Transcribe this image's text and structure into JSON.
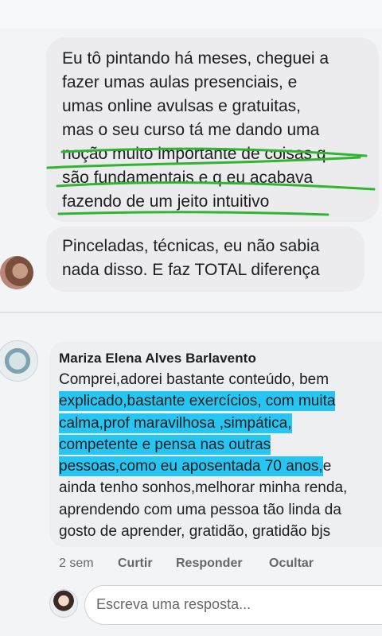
{
  "message1": {
    "lines": [
      "Eu tô pintando há meses, cheguei a",
      "fazer umas aulas presenciais, e",
      "umas online avulsas e gratuitas,",
      "mas o seu curso tá me dando uma",
      "noção muito importante de coisas q",
      "são fundamentais e q eu acabava",
      "fazendo de um jeito intuitivo"
    ]
  },
  "message2": {
    "lines": [
      "Pinceladas, técnicas, eu não sabia",
      "nada disso. E faz TOTAL diferença"
    ]
  },
  "comment": {
    "author": "Mariza Elena Alves Barlavento",
    "line1": "Comprei,adorei  bastante conteúdo, bem",
    "line2": "explicado,bastante exercícios, com muita",
    "line3": "calma,prof maravilhosa  ,simpática,",
    "line4": "competente e pensa nas outras",
    "line5_hl": "pessoas,como eu aposentada 70 anos,",
    "line5_rest": "e",
    "line6": "ainda tenho sonhos,melhorar minha renda,",
    "line7": "aprendendo com uma pessoa tão  linda da",
    "line8": "gosto de aprender, gratidão, gratidão  bjs"
  },
  "actions": {
    "time": "2 sem",
    "like": "Curtir",
    "reply": "Responder",
    "hide": "Ocultar"
  },
  "reply_box": {
    "placeholder": "Escreva uma resposta..."
  },
  "colors": {
    "highlight": "#27c6f2",
    "pen_underline": "#2fb52f"
  }
}
